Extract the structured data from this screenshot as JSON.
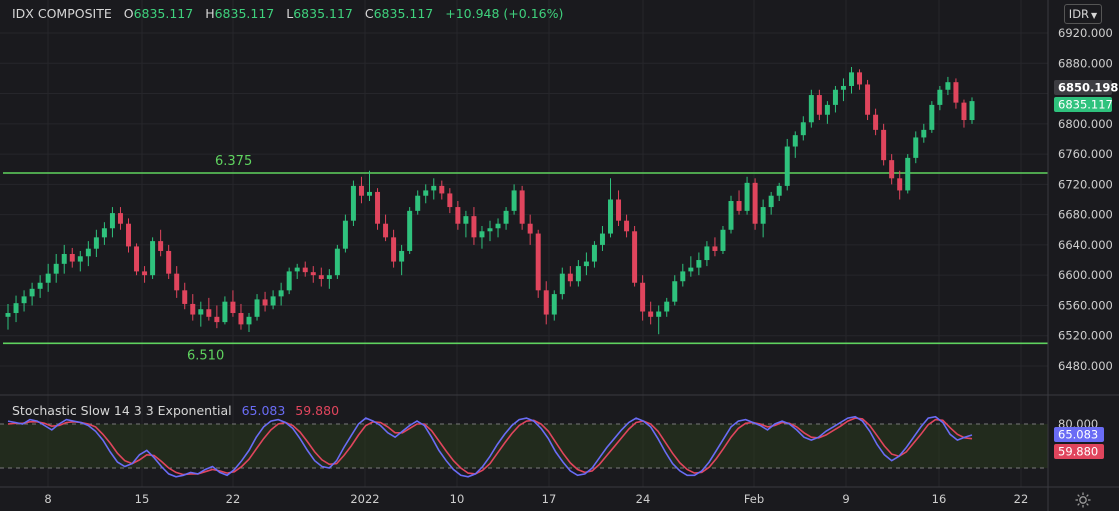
{
  "header": {
    "symbol": "IDX COMPOSITE",
    "open_label": "O",
    "open": "6835.117",
    "high_label": "H",
    "high": "6835.117",
    "low_label": "L",
    "low": "6835.117",
    "close_label": "C",
    "close": "6835.117",
    "change": "+10.948 (+0.16%)"
  },
  "currency_button": "IDR",
  "price_scale": {
    "ticks": [
      "6920.000",
      "6880.000",
      "6850.198",
      "6835.117",
      "6800.000",
      "6760.000",
      "6720.000",
      "6680.000",
      "6640.000",
      "6600.000",
      "6560.000",
      "6520.000",
      "6480.000"
    ],
    "ref_price_tag": "6850.198",
    "last_price_tag": "6835.117"
  },
  "stochastic": {
    "title": "Stochastic Slow 14 3 3 Exponential",
    "k_value": "65.083",
    "d_value": "59.880",
    "scale_label": "80.000"
  },
  "time_axis": [
    "8",
    "15",
    "22",
    "2022",
    "10",
    "17",
    "24",
    "Feb",
    "9",
    "16",
    "22"
  ],
  "annotations": {
    "resistance_label": "6.375",
    "support_label": "6.510"
  },
  "colors": {
    "background": "#1a1a1e",
    "up": "#2fc27d",
    "down": "#e0455d",
    "horizontal_lines": "#5fd35f",
    "stoch_k": "#6a6cf5",
    "stoch_d": "#e0455d",
    "stoch_band": "#2a3a1e"
  },
  "chart_data": {
    "type": "candlestick",
    "ylim": [
      6460,
      6940
    ],
    "horizontal_lines": [
      6735,
      6510
    ],
    "candles": [
      [
        6545,
        6562,
        6528,
        6550
      ],
      [
        6550,
        6573,
        6538,
        6563
      ],
      [
        6563,
        6580,
        6552,
        6572
      ],
      [
        6572,
        6590,
        6560,
        6582
      ],
      [
        6582,
        6600,
        6570,
        6590
      ],
      [
        6590,
        6615,
        6578,
        6602
      ],
      [
        6602,
        6628,
        6590,
        6615
      ],
      [
        6615,
        6640,
        6602,
        6628
      ],
      [
        6628,
        6636,
        6610,
        6618
      ],
      [
        6618,
        6632,
        6605,
        6625
      ],
      [
        6625,
        6645,
        6612,
        6635
      ],
      [
        6635,
        6660,
        6624,
        6650
      ],
      [
        6650,
        6670,
        6640,
        6662
      ],
      [
        6662,
        6690,
        6650,
        6682
      ],
      [
        6682,
        6690,
        6660,
        6668
      ],
      [
        6668,
        6675,
        6630,
        6638
      ],
      [
        6638,
        6642,
        6600,
        6605
      ],
      [
        6605,
        6612,
        6590,
        6600
      ],
      [
        6600,
        6650,
        6595,
        6645
      ],
      [
        6645,
        6660,
        6625,
        6632
      ],
      [
        6632,
        6640,
        6595,
        6602
      ],
      [
        6602,
        6612,
        6570,
        6580
      ],
      [
        6580,
        6590,
        6555,
        6562
      ],
      [
        6562,
        6575,
        6540,
        6548
      ],
      [
        6548,
        6565,
        6532,
        6555
      ],
      [
        6555,
        6570,
        6540,
        6545
      ],
      [
        6545,
        6560,
        6530,
        6538
      ],
      [
        6538,
        6572,
        6535,
        6565
      ],
      [
        6565,
        6580,
        6545,
        6550
      ],
      [
        6550,
        6562,
        6528,
        6535
      ],
      [
        6535,
        6550,
        6525,
        6545
      ],
      [
        6545,
        6575,
        6540,
        6568
      ],
      [
        6568,
        6578,
        6552,
        6560
      ],
      [
        6560,
        6580,
        6555,
        6572
      ],
      [
        6572,
        6590,
        6560,
        6580
      ],
      [
        6580,
        6610,
        6575,
        6605
      ],
      [
        6605,
        6615,
        6595,
        6610
      ],
      [
        6610,
        6618,
        6598,
        6604
      ],
      [
        6604,
        6612,
        6590,
        6600
      ],
      [
        6600,
        6610,
        6585,
        6595
      ],
      [
        6595,
        6608,
        6582,
        6600
      ],
      [
        6600,
        6640,
        6595,
        6635
      ],
      [
        6635,
        6680,
        6630,
        6672
      ],
      [
        6672,
        6725,
        6665,
        6718
      ],
      [
        6718,
        6730,
        6695,
        6705
      ],
      [
        6705,
        6738,
        6698,
        6710
      ],
      [
        6710,
        6715,
        6660,
        6668
      ],
      [
        6668,
        6680,
        6645,
        6650
      ],
      [
        6650,
        6660,
        6610,
        6618
      ],
      [
        6618,
        6640,
        6600,
        6632
      ],
      [
        6632,
        6690,
        6628,
        6685
      ],
      [
        6685,
        6712,
        6680,
        6705
      ],
      [
        6705,
        6720,
        6695,
        6712
      ],
      [
        6712,
        6728,
        6700,
        6718
      ],
      [
        6718,
        6725,
        6700,
        6708
      ],
      [
        6708,
        6715,
        6682,
        6690
      ],
      [
        6690,
        6698,
        6660,
        6668
      ],
      [
        6668,
        6685,
        6650,
        6678
      ],
      [
        6678,
        6690,
        6640,
        6650
      ],
      [
        6650,
        6665,
        6635,
        6658
      ],
      [
        6658,
        6672,
        6645,
        6662
      ],
      [
        6662,
        6675,
        6650,
        6668
      ],
      [
        6668,
        6690,
        6660,
        6685
      ],
      [
        6685,
        6720,
        6680,
        6712
      ],
      [
        6712,
        6718,
        6660,
        6668
      ],
      [
        6668,
        6680,
        6640,
        6655
      ],
      [
        6655,
        6660,
        6570,
        6580
      ],
      [
        6580,
        6592,
        6535,
        6548
      ],
      [
        6548,
        6580,
        6540,
        6575
      ],
      [
        6575,
        6610,
        6568,
        6602
      ],
      [
        6602,
        6612,
        6585,
        6592
      ],
      [
        6592,
        6620,
        6585,
        6612
      ],
      [
        6612,
        6630,
        6600,
        6618
      ],
      [
        6618,
        6645,
        6610,
        6640
      ],
      [
        6640,
        6665,
        6632,
        6655
      ],
      [
        6655,
        6728,
        6650,
        6700
      ],
      [
        6700,
        6712,
        6665,
        6672
      ],
      [
        6672,
        6680,
        6650,
        6658
      ],
      [
        6658,
        6665,
        6585,
        6590
      ],
      [
        6590,
        6600,
        6540,
        6552
      ],
      [
        6552,
        6565,
        6535,
        6545
      ],
      [
        6545,
        6560,
        6522,
        6552
      ],
      [
        6552,
        6570,
        6545,
        6565
      ],
      [
        6565,
        6600,
        6560,
        6592
      ],
      [
        6592,
        6615,
        6585,
        6605
      ],
      [
        6605,
        6625,
        6598,
        6610
      ],
      [
        6610,
        6630,
        6600,
        6620
      ],
      [
        6620,
        6645,
        6612,
        6638
      ],
      [
        6638,
        6650,
        6625,
        6632
      ],
      [
        6632,
        6665,
        6628,
        6660
      ],
      [
        6660,
        6705,
        6655,
        6698
      ],
      [
        6698,
        6712,
        6680,
        6685
      ],
      [
        6685,
        6730,
        6680,
        6722
      ],
      [
        6722,
        6728,
        6660,
        6668
      ],
      [
        6668,
        6700,
        6650,
        6690
      ],
      [
        6690,
        6710,
        6680,
        6705
      ],
      [
        6705,
        6722,
        6698,
        6718
      ],
      [
        6718,
        6780,
        6712,
        6770
      ],
      [
        6770,
        6790,
        6755,
        6785
      ],
      [
        6785,
        6810,
        6778,
        6802
      ],
      [
        6802,
        6845,
        6795,
        6838
      ],
      [
        6838,
        6845,
        6805,
        6812
      ],
      [
        6812,
        6830,
        6800,
        6825
      ],
      [
        6825,
        6850,
        6815,
        6845
      ],
      [
        6845,
        6860,
        6830,
        6850
      ],
      [
        6850,
        6875,
        6840,
        6868
      ],
      [
        6868,
        6872,
        6845,
        6852
      ],
      [
        6852,
        6858,
        6805,
        6812
      ],
      [
        6812,
        6820,
        6785,
        6792
      ],
      [
        6792,
        6800,
        6745,
        6752
      ],
      [
        6752,
        6760,
        6720,
        6728
      ],
      [
        6728,
        6738,
        6700,
        6712
      ],
      [
        6712,
        6760,
        6708,
        6755
      ],
      [
        6755,
        6790,
        6748,
        6782
      ],
      [
        6782,
        6800,
        6775,
        6792
      ],
      [
        6792,
        6830,
        6788,
        6825
      ],
      [
        6825,
        6850,
        6818,
        6845
      ],
      [
        6845,
        6862,
        6838,
        6855
      ],
      [
        6855,
        6860,
        6820,
        6828
      ],
      [
        6828,
        6832,
        6795,
        6805
      ],
      [
        6805,
        6835,
        6800,
        6830
      ]
    ],
    "stochastic_k": [
      84,
      82,
      80,
      86,
      84,
      78,
      72,
      80,
      86,
      84,
      82,
      78,
      70,
      58,
      42,
      28,
      22,
      26,
      38,
      44,
      34,
      22,
      12,
      8,
      10,
      14,
      12,
      18,
      22,
      14,
      10,
      18,
      30,
      44,
      62,
      76,
      84,
      86,
      82,
      74,
      60,
      44,
      30,
      22,
      20,
      30,
      48,
      64,
      80,
      88,
      84,
      78,
      68,
      62,
      70,
      78,
      84,
      78,
      62,
      44,
      30,
      18,
      10,
      8,
      12,
      22,
      36,
      52,
      66,
      78,
      86,
      88,
      84,
      74,
      60,
      42,
      28,
      16,
      10,
      12,
      20,
      34,
      48,
      60,
      72,
      82,
      88,
      84,
      76,
      60,
      42,
      26,
      16,
      10,
      10,
      16,
      28,
      44,
      60,
      76,
      84,
      86,
      82,
      78,
      72,
      80,
      84,
      80,
      72,
      62,
      58,
      62,
      70,
      76,
      82,
      88,
      90,
      84,
      70,
      52,
      38,
      30,
      36,
      48,
      62,
      76,
      88,
      90,
      82,
      66,
      58,
      62,
      65
    ],
    "stochastic_d": [
      80,
      81,
      81,
      83,
      83,
      81,
      77,
      78,
      82,
      83,
      82,
      80,
      76,
      66,
      54,
      40,
      30,
      26,
      31,
      38,
      37,
      29,
      20,
      14,
      11,
      12,
      12,
      15,
      18,
      16,
      13,
      15,
      22,
      32,
      46,
      60,
      72,
      80,
      82,
      78,
      69,
      56,
      42,
      31,
      25,
      26,
      37,
      50,
      65,
      78,
      83,
      82,
      76,
      68,
      68,
      74,
      80,
      80,
      71,
      57,
      43,
      30,
      20,
      13,
      12,
      17,
      26,
      40,
      54,
      67,
      78,
      84,
      85,
      80,
      70,
      55,
      40,
      27,
      18,
      14,
      16,
      25,
      37,
      49,
      61,
      73,
      82,
      84,
      80,
      70,
      55,
      40,
      27,
      18,
      13,
      14,
      21,
      33,
      47,
      62,
      74,
      81,
      82,
      80,
      76,
      78,
      82,
      81,
      76,
      68,
      62,
      61,
      65,
      71,
      77,
      84,
      88,
      87,
      78,
      64,
      50,
      39,
      36,
      42,
      54,
      66,
      79,
      86,
      85,
      75,
      66,
      61,
      60
    ]
  }
}
